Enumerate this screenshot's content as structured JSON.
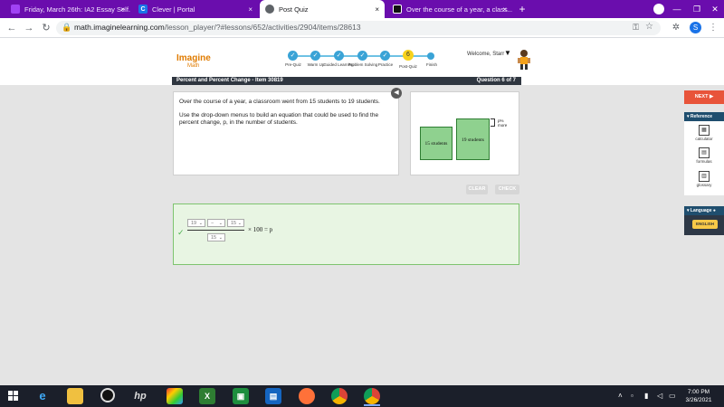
{
  "browser": {
    "tabs": [
      {
        "title": "Friday, March 26th: IA2 Essay Self...",
        "favicon_color": "#a142f4"
      },
      {
        "title": "Clever | Portal",
        "favicon_color": "#1a73e8",
        "favicon_letter": "C"
      },
      {
        "title": "Post Quiz",
        "favicon_color": "#5f6368",
        "active": true
      },
      {
        "title": "Over the course of a year, a class...",
        "favicon_color": "#111111"
      }
    ],
    "close_glyph": "×",
    "new_tab": "+",
    "url_host": "math.imaginelearning.com",
    "url_path": "/lesson_player/?#lessons/652/activities/2904/items/28613",
    "profile_letter": "S"
  },
  "app": {
    "logo_line1": "Imagine",
    "logo_line2": "Math",
    "steps": [
      {
        "label": "Pre-Quiz",
        "state": "done"
      },
      {
        "label": "Warm Up",
        "state": "done"
      },
      {
        "label": "Guided Learning",
        "state": "done"
      },
      {
        "label": "Problem Solving",
        "state": "done"
      },
      {
        "label": "Practice",
        "state": "done"
      },
      {
        "label": "Post-Quiz",
        "state": "current",
        "number": "6"
      },
      {
        "label": "Finish",
        "state": "todo"
      }
    ],
    "welcome": "Welcome, Starr",
    "item_title": "Percent and Percent Change - Item 30819",
    "question_counter": "Question 6 of 7"
  },
  "question": {
    "paragraph1": "Over the course of a year, a classroom went from 15 students to 19 students.",
    "paragraph2": "Use the drop-down menus to build an equation that could be used to find the percent change, p, in the number of students."
  },
  "diagram": {
    "bar_left_label": "15 students",
    "bar_right_label": "19 students",
    "pct_label_1": "p%",
    "pct_label_2": "more",
    "values": {
      "before": 15,
      "after": 19
    }
  },
  "buttons": {
    "clear": "CLEAR",
    "check": "CHECK",
    "next": "NEXT ▶"
  },
  "answer": {
    "numerator_1": "19",
    "operator": "−",
    "numerator_2": "15",
    "denominator": "15",
    "suffix": "× 100 = p",
    "check_glyph": "✓"
  },
  "reference": {
    "header": "Reference",
    "items": [
      "calculator",
      "formulas",
      "glossary"
    ]
  },
  "language": {
    "header": "Language",
    "english": "ENGLISH"
  },
  "taskbar": {
    "time": "7:00 PM",
    "date": "3/26/2021"
  }
}
